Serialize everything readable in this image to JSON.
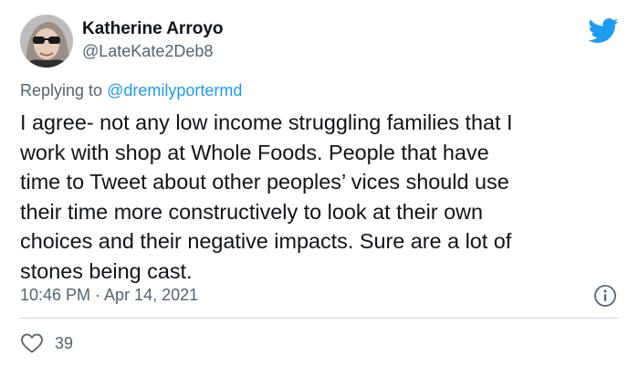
{
  "author": {
    "display_name": "Katherine Arroyo",
    "handle": "@LateKate2Deb8"
  },
  "reply": {
    "prefix": "Replying to ",
    "mention": "@dremilyportermd"
  },
  "tweet": {
    "text": "I agree- not any low income struggling families that I\nwork with shop at Whole Foods. People that have\ntime to Tweet about other peoples’ vices should use\ntheir time more constructively to look at their own\nchoices and their negative impacts. Sure are a lot of\nstones being cast.",
    "timestamp": "10:46 PM · Apr 14, 2021"
  },
  "metrics": {
    "likes": "39"
  },
  "icons": {
    "brand": "twitter-bird-icon",
    "info": "info-icon",
    "like": "heart-icon"
  },
  "colors": {
    "brand_blue": "#1d9bf0",
    "text": "#0f1419",
    "secondary_text": "#536471",
    "divider": "#cfd9de"
  }
}
